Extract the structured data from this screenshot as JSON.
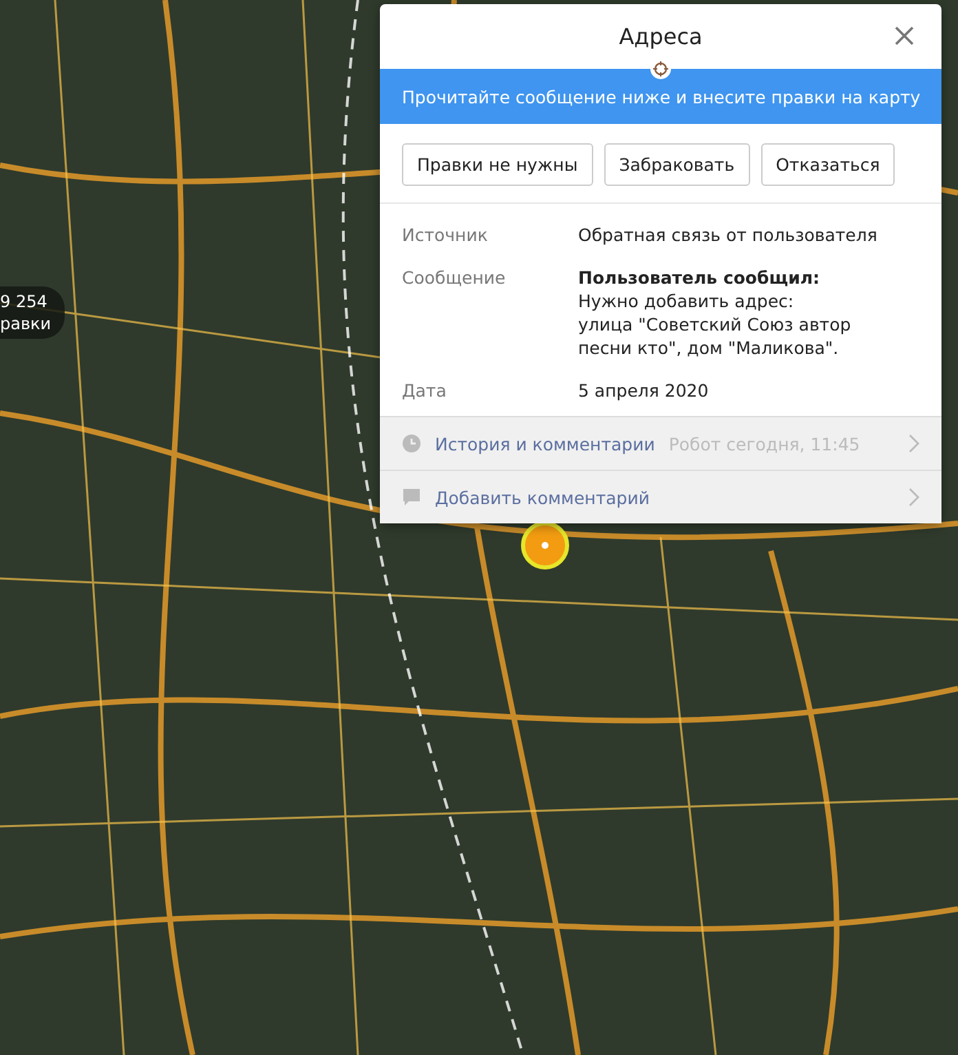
{
  "map_badge": {
    "count": "9 254",
    "label": "равки"
  },
  "panel": {
    "title": "Адреса",
    "banner": "Прочитайте сообщение ниже и внесите правки на карту",
    "buttons": [
      "Правки не нужны",
      "Забраковать",
      "Отказаться"
    ],
    "fields": [
      {
        "label": "Источник",
        "value": "Обратная связь от пользователя"
      },
      {
        "label": "Сообщение",
        "value": "**Пользователь сообщил:**\nНужно добавить адрес:\nулица \"Советский Союз автор песни кто\", дом \"Маликова\"."
      },
      {
        "label": "Дата",
        "value": "5 апреля 2020"
      }
    ],
    "links": [
      {
        "kind": "history",
        "label": "История и комментарии",
        "meta": "Робот сегодня, 11:45"
      },
      {
        "kind": "comment",
        "label": "Добавить комментарий"
      }
    ]
  }
}
